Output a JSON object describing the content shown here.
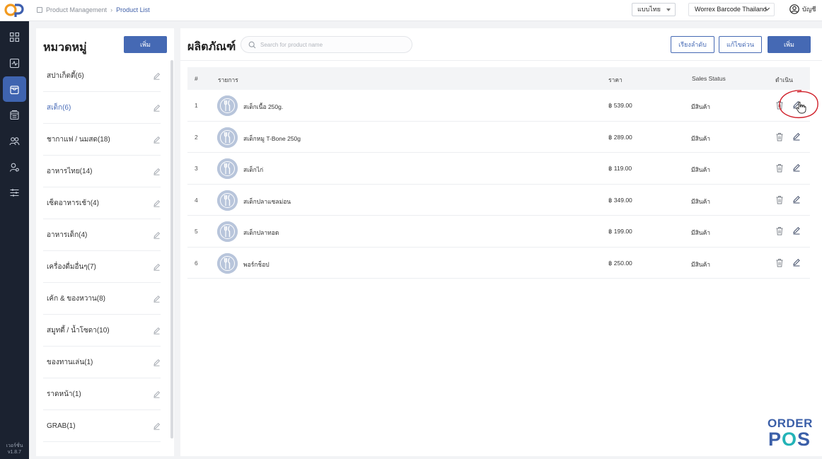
{
  "header": {
    "breadcrumb": [
      "Product Management",
      "Product List"
    ],
    "language": "แบบไทย",
    "store": "Worrex Barcode Thailand",
    "account": "บัญชี"
  },
  "nav": {
    "items": [
      "dashboard-icon",
      "analytics-icon",
      "product-icon",
      "menu-icon",
      "customers-icon",
      "user-icon",
      "settings-icon"
    ],
    "active": "product-icon",
    "version_label": "เวอร์ชั่น",
    "version": "v1.8.7"
  },
  "categories": {
    "title": "หมวดหมู่",
    "add_label": "เพิ่ม",
    "items": [
      "สปาเก็ตตี้(6)",
      "สเต็ก(6)",
      "ชากาแฟ / นมสด(18)",
      "อาหารไทย(14)",
      "เซ็ตอาหารเช้า(4)",
      "อาหารเด็ก(4)",
      "เครื่องดื่มอื่นๆ(7)",
      "เค้ก & ของหวาน(8)",
      "สมูทตี้ / น้ำโซดา(10)",
      "ของทานเล่น(1)",
      "ราดหน้า(1)",
      "GRAB(1)"
    ],
    "active_index": 1
  },
  "products": {
    "title": "ผลิตภัณฑ์",
    "search_placeholder": "Search for product name",
    "sort_label": "เรียงลำดับ",
    "quick_edit_label": "แก้ไขด่วน",
    "add_label": "เพิ่ม",
    "columns": {
      "index": "#",
      "item": "รายการ",
      "price": "ราคา",
      "status": "Sales Status",
      "action": "ดำเนิน"
    },
    "rows": [
      {
        "index": "1",
        "name": "สเต็กเนื้อ 250g.",
        "price": "฿ 539.00",
        "status": "มีสินค้า"
      },
      {
        "index": "2",
        "name": "สเต็กหมู T-Bone 250g",
        "price": "฿ 289.00",
        "status": "มีสินค้า"
      },
      {
        "index": "3",
        "name": "สเต็กไก่",
        "price": "฿ 119.00",
        "status": "มีสินค้า"
      },
      {
        "index": "4",
        "name": "สเต็กปลาแซลม่อน",
        "price": "฿ 349.00",
        "status": "มีสินค้า"
      },
      {
        "index": "5",
        "name": "สเต็กปลาทอด",
        "price": "฿ 199.00",
        "status": "มีสินค้า"
      },
      {
        "index": "6",
        "name": "พอร์กช็อป",
        "price": "฿ 250.00",
        "status": "มีสินค้า"
      }
    ]
  },
  "brand": {
    "line1": "ORDER",
    "line2_a": "P",
    "line2_o": "O",
    "line2_b": "S"
  },
  "colors": {
    "primary": "#4569b4",
    "nav_bg": "#1b2230",
    "annotation": "#d0202a",
    "brand_teal": "#23b3b7"
  }
}
